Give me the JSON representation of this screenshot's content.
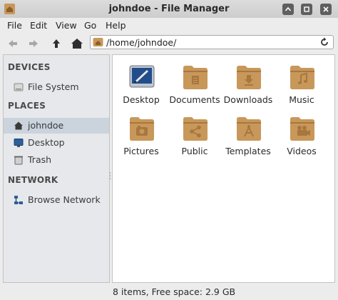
{
  "window": {
    "title": "johndoe - File Manager"
  },
  "menu": [
    "File",
    "Edit",
    "View",
    "Go",
    "Help"
  ],
  "toolbar": {
    "buttons": [
      {
        "name": "back-arrow-icon"
      },
      {
        "name": "forward-arrow-icon"
      },
      {
        "name": "up-arrow-icon"
      },
      {
        "name": "home-icon"
      }
    ],
    "path": "/home/johndoe/"
  },
  "sidebar": {
    "sections": [
      {
        "header": "DEVICES",
        "items": [
          {
            "label": "File System",
            "icon": "harddisk-icon"
          }
        ]
      },
      {
        "header": "PLACES",
        "items": [
          {
            "label": "johndoe",
            "icon": "home-icon",
            "selected": true
          },
          {
            "label": "Desktop",
            "icon": "desktop-icon"
          },
          {
            "label": "Trash",
            "icon": "trash-icon"
          }
        ]
      },
      {
        "header": "NETWORK",
        "items": [
          {
            "label": "Browse Network",
            "icon": "network-icon"
          }
        ]
      }
    ]
  },
  "folders": [
    {
      "label": "Desktop",
      "icon": "desktop-folder-icon"
    },
    {
      "label": "Documents",
      "icon": "documents-folder-icon"
    },
    {
      "label": "Downloads",
      "icon": "downloads-folder-icon"
    },
    {
      "label": "Music",
      "icon": "music-folder-icon"
    },
    {
      "label": "Pictures",
      "icon": "pictures-folder-icon"
    },
    {
      "label": "Public",
      "icon": "public-folder-icon"
    },
    {
      "label": "Templates",
      "icon": "templates-folder-icon"
    },
    {
      "label": "Videos",
      "icon": "videos-folder-icon"
    }
  ],
  "status": "8 items, Free space: 2.9 GB",
  "colors": {
    "folder": "#c8975a",
    "folder_dark": "#a8773e",
    "selection": "#cbd3dd",
    "sidebar_bg": "#e6e8eb"
  }
}
